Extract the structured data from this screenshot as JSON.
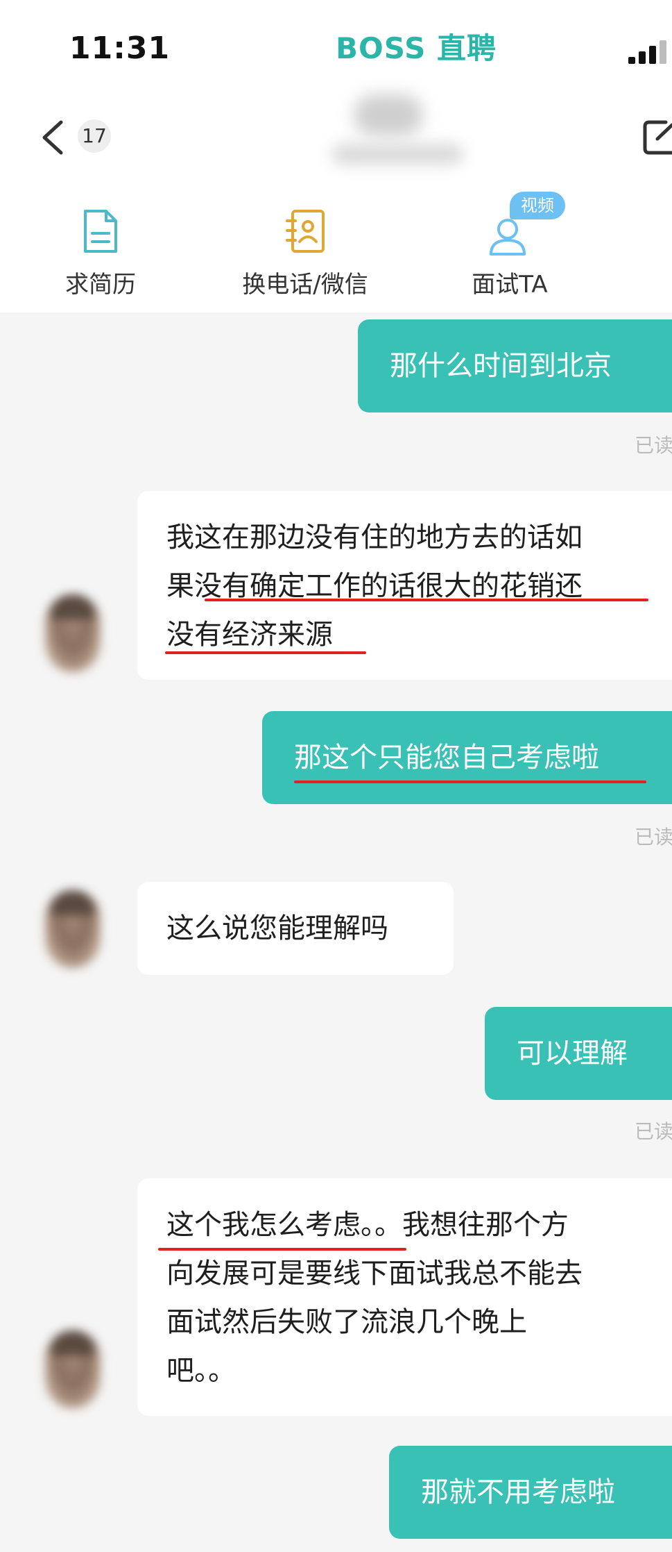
{
  "status_bar": {
    "time": "11:31",
    "brand": "BOSS 直聘",
    "signal_icon": "cellular-signal-icon"
  },
  "header": {
    "unread_count": "17",
    "back_icon": "chevron-left-icon",
    "share_icon": "share-icon"
  },
  "actions": [
    {
      "label": "求简历",
      "icon": "resume-document-icon"
    },
    {
      "label": "换电话/微信",
      "icon": "contact-card-icon"
    },
    {
      "label": "面试TA",
      "icon": "person-icon",
      "badge": "视频"
    }
  ],
  "messages": [
    {
      "side": "out",
      "text": "那什么时间到北京",
      "read": "已读"
    },
    {
      "side": "in",
      "text": "我这在那边没有住的地方去的话如\n果没有确定工作的话很大的花销还\n没有经济来源"
    },
    {
      "side": "out",
      "text": "那这个只能您自己考虑啦",
      "read": "已读"
    },
    {
      "side": "in",
      "text": "这么说您能理解吗"
    },
    {
      "side": "out",
      "text": "可以理解",
      "read": "已读"
    },
    {
      "side": "in",
      "text": "这个我怎么考虑。。我想往那个方\n向发展可是要线下面试我总不能去\n面试然后失败了流浪几个晚上\n吧。。"
    },
    {
      "side": "out",
      "text": "那就不用考虑啦"
    }
  ],
  "colors": {
    "accent": "#39c1b5",
    "brand": "#2bb5a8",
    "underline": "#e22121",
    "resume_icon": "#4bb9c9",
    "contact_icon": "#e0a734",
    "badge": "#6cc0f2"
  }
}
